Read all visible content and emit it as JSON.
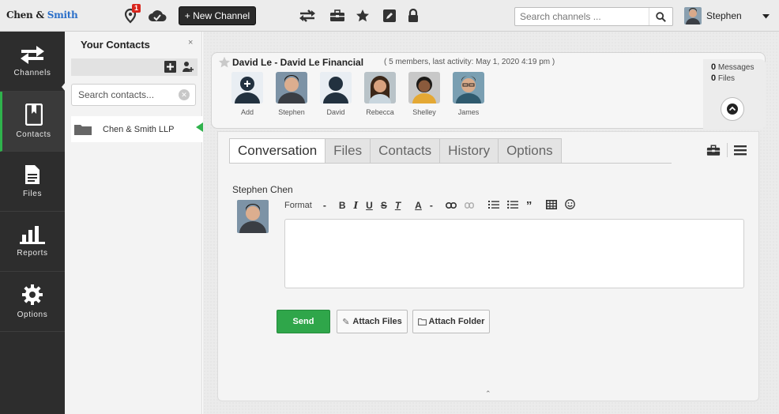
{
  "app": {
    "logo_part1": "Chen &",
    "logo_part2": "Smith"
  },
  "topbar": {
    "notification_count": "1",
    "new_channel_label": "+ New Channel",
    "search_placeholder": "Search channels ...",
    "user_name": "Stephen"
  },
  "nav": [
    {
      "label": "Channels",
      "icon": "channels-arrows-icon"
    },
    {
      "label": "Contacts",
      "icon": "contacts-book-icon"
    },
    {
      "label": "Files",
      "icon": "file-icon"
    },
    {
      "label": "Reports",
      "icon": "bar-chart-icon"
    },
    {
      "label": "Options",
      "icon": "gear-icon"
    }
  ],
  "contacts": {
    "title": "Your Contacts",
    "close": "×",
    "search_placeholder": "Search contacts...",
    "items": [
      {
        "label": "Chen & Smith LLP"
      }
    ]
  },
  "channel": {
    "title": "David Le - David Le Financial",
    "meta": "( 5 members, last activity: May 1, 2020 4:19 pm )",
    "members": [
      {
        "name": "Add"
      },
      {
        "name": "Stephen"
      },
      {
        "name": "David"
      },
      {
        "name": "Rebecca"
      },
      {
        "name": "Shelley"
      },
      {
        "name": "James"
      }
    ],
    "messages_count": "0",
    "messages_label": "Messages",
    "files_count": "0",
    "files_label": "Files"
  },
  "tabs": [
    "Conversation",
    "Files",
    "Contacts",
    "History",
    "Options"
  ],
  "composer": {
    "author": "Stephen Chen",
    "format_label": "Format",
    "send_label": "Send",
    "attach_files_label": "Attach Files",
    "attach_folder_label": "Attach Folder"
  },
  "colors": {
    "accent_green": "#2fa64a",
    "logo_blue": "#2a6fc9",
    "nav_bg": "#2d2d2d",
    "badge_red": "#d9251c"
  }
}
